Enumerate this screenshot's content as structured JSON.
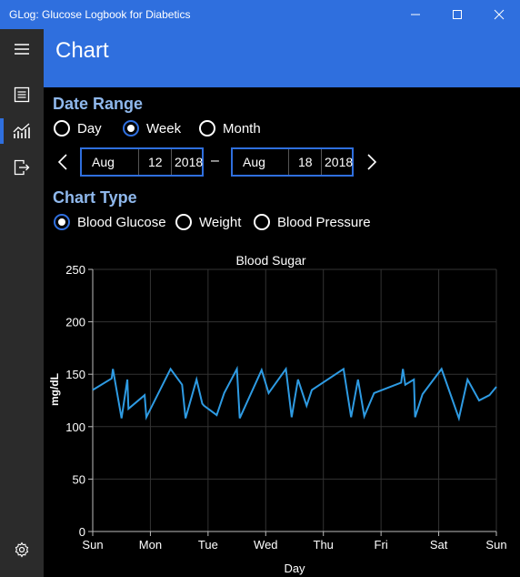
{
  "window": {
    "title": "GLog: Glucose Logbook for Diabetics"
  },
  "header": {
    "title": "Chart"
  },
  "nav": {
    "items": [
      {
        "icon": "hamburger-icon"
      },
      {
        "icon": "list-icon"
      },
      {
        "icon": "chart-icon",
        "active": true
      },
      {
        "icon": "export-icon"
      },
      {
        "icon": "gear-icon"
      }
    ]
  },
  "date_range": {
    "title": "Date Range",
    "options": [
      "Day",
      "Week",
      "Month"
    ],
    "selected": "Week",
    "from": {
      "month": "Aug",
      "day": "12",
      "year": "2018"
    },
    "to": {
      "month": "Aug",
      "day": "18",
      "year": "2018"
    },
    "separator": "–"
  },
  "chart_type": {
    "title": "Chart Type",
    "options": [
      "Blood Glucose",
      "Weight",
      "Blood Pressure"
    ],
    "selected": "Blood Glucose"
  },
  "colors": {
    "accent": "#2f6fde",
    "section": "#8fb8ec",
    "line": "#2e9be3"
  },
  "chart_data": {
    "type": "line",
    "title": "Blood Sugar",
    "xlabel": "Day",
    "ylabel": "mg/dL",
    "ylim": [
      0,
      250
    ],
    "yticks": [
      0,
      50,
      100,
      150,
      200,
      250
    ],
    "xlim": [
      0,
      7
    ],
    "xticks": [
      "Sun",
      "Mon",
      "Tue",
      "Wed",
      "Thu",
      "Fri",
      "Sat",
      "Sun"
    ],
    "grid": true,
    "series": [
      {
        "x": [
          0,
          0.33,
          0.35,
          0.5,
          0.6,
          0.62,
          0.9,
          0.93,
          1.35,
          1.55,
          1.61,
          1.8,
          1.9,
          1.93,
          2.15,
          2.28,
          2.5,
          2.55,
          2.93,
          3.05,
          3.35,
          3.45,
          3.56,
          3.71,
          3.8,
          4.35,
          4.48,
          4.6,
          4.71,
          4.88,
          5.35,
          5.38,
          5.42,
          5.57,
          5.59,
          5.72,
          6.05,
          6.35,
          6.5,
          6.7,
          6.88,
          7
        ],
        "y": [
          135,
          146,
          155,
          108,
          145,
          117,
          130,
          109,
          155,
          140,
          108,
          145,
          122,
          120,
          111,
          132,
          155,
          108,
          154,
          132,
          155,
          109,
          145,
          120,
          135,
          155,
          109,
          145,
          110,
          132,
          142,
          155,
          140,
          145,
          109,
          131,
          155,
          108,
          145,
          125,
          130,
          138
        ]
      }
    ]
  }
}
